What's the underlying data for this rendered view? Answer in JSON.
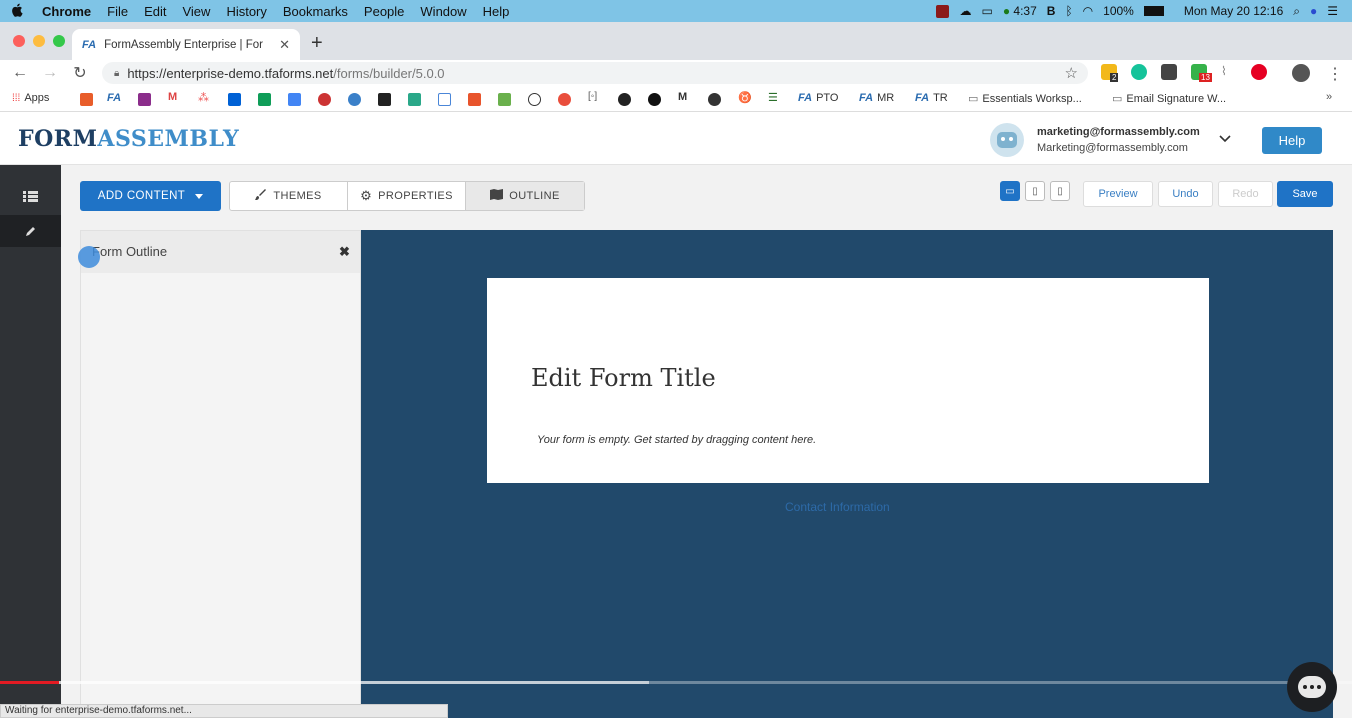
{
  "menubar": {
    "apple": "",
    "items": [
      "Chrome",
      "File",
      "Edit",
      "View",
      "History",
      "Bookmarks",
      "People",
      "Window",
      "Help"
    ],
    "status": {
      "timer": "4:37",
      "battery": "100%",
      "datetime": "Mon May 20  12:16"
    }
  },
  "browser": {
    "tab_title": "FormAssembly Enterprise | For",
    "tab_favicon": "FA",
    "url_host": "https://enterprise-demo.tfaforms.net",
    "url_path": "/forms/builder/5.0.0",
    "ext_badges": {
      "badge1": "2",
      "badge2": "13"
    }
  },
  "bookmarks": {
    "apps": "Apps",
    "pto": "PTO",
    "mr": "MR",
    "tr": "TR",
    "folder1": "Essentials Worksp...",
    "folder2": "Email Signature W...",
    "more": "»"
  },
  "app": {
    "logo_part1": "FORM",
    "logo_part2": "ASSEMBLY",
    "user_email": "marketing@formassembly.com",
    "user_name": "Marketing@formassembly.com",
    "help_label": "Help"
  },
  "toolbar": {
    "add_content": "ADD CONTENT",
    "themes": "THEMES",
    "properties": "PROPERTIES",
    "outline": "OUTLINE",
    "preview": "Preview",
    "undo": "Undo",
    "redo": "Redo",
    "save": "Save"
  },
  "outline_panel": {
    "title": "Form Outline",
    "close": "✖"
  },
  "form": {
    "title": "Edit Form Title",
    "empty_message": "Your form is empty. Get started by dragging content here.",
    "section_label": "Contact Information"
  },
  "status_bar": "Waiting for enterprise-demo.tfaforms.net...",
  "video": {
    "progress_played": 0.044,
    "progress_loaded": 0.48
  },
  "colors": {
    "accent": "#1f73c6",
    "canvas": "#21496b",
    "logo_dark": "#1e3f63",
    "logo_light": "#3f8dc9"
  }
}
